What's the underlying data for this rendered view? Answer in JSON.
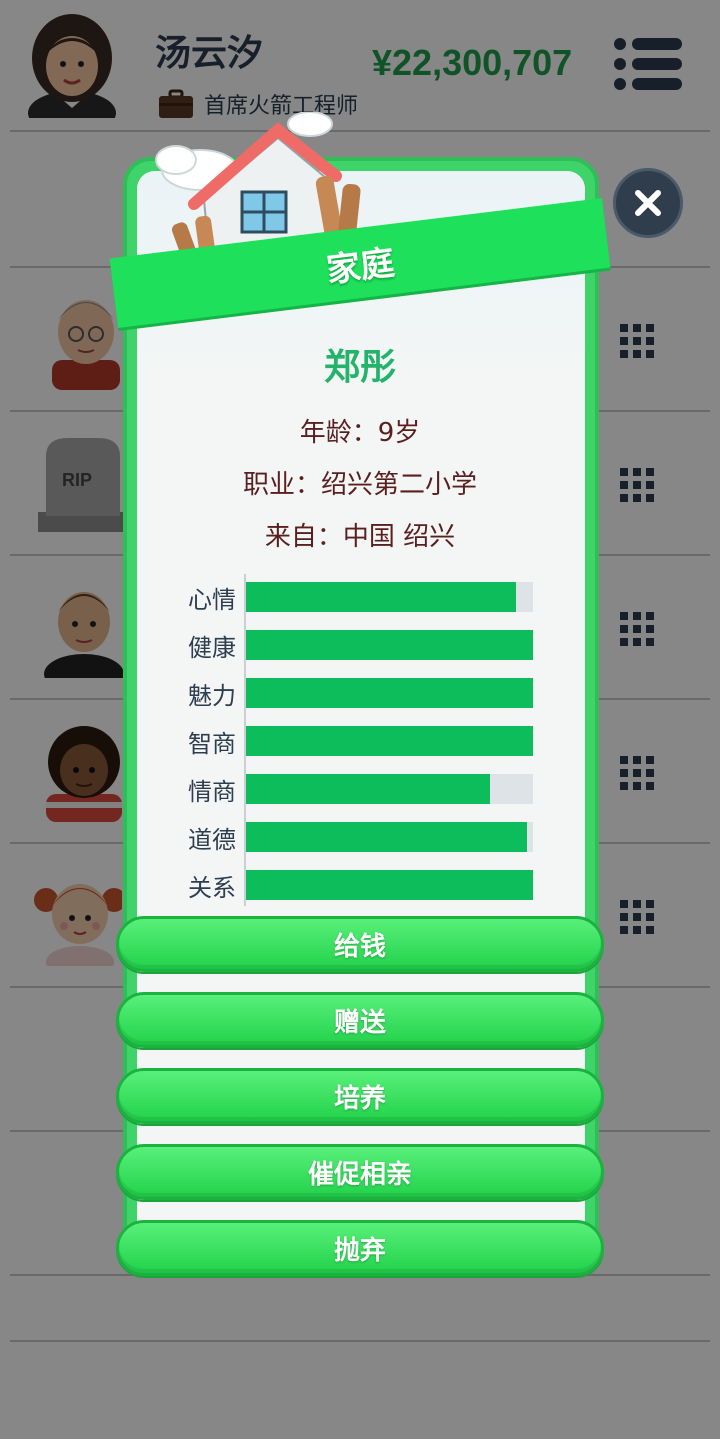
{
  "header": {
    "player_name": "汤云汐",
    "job_title": "首席火箭工程师",
    "money": "¥22,300,707"
  },
  "family_list": {
    "tombstone_text": "RIP"
  },
  "modal": {
    "banner_title": "家庭",
    "member_name": "郑彤",
    "age_line": "年龄：9岁",
    "job_line": "职业：绍兴第二小学",
    "origin_line": "来自：中国 绍兴",
    "stats": [
      {
        "label": "心情",
        "value": 0.94
      },
      {
        "label": "健康",
        "value": 1.0
      },
      {
        "label": "魅力",
        "value": 1.0
      },
      {
        "label": "智商",
        "value": 1.0
      },
      {
        "label": "情商",
        "value": 0.85
      },
      {
        "label": "道德",
        "value": 0.98
      },
      {
        "label": "关系",
        "value": 1.0
      }
    ],
    "actions": [
      "给钱",
      "赠送",
      "培养",
      "催促相亲",
      "抛弃"
    ]
  },
  "colors": {
    "accent_green": "#1ee05a",
    "money_green": "#1f9e4a",
    "stat_fill": "#0dbd5b",
    "name_green": "#23b36a"
  }
}
